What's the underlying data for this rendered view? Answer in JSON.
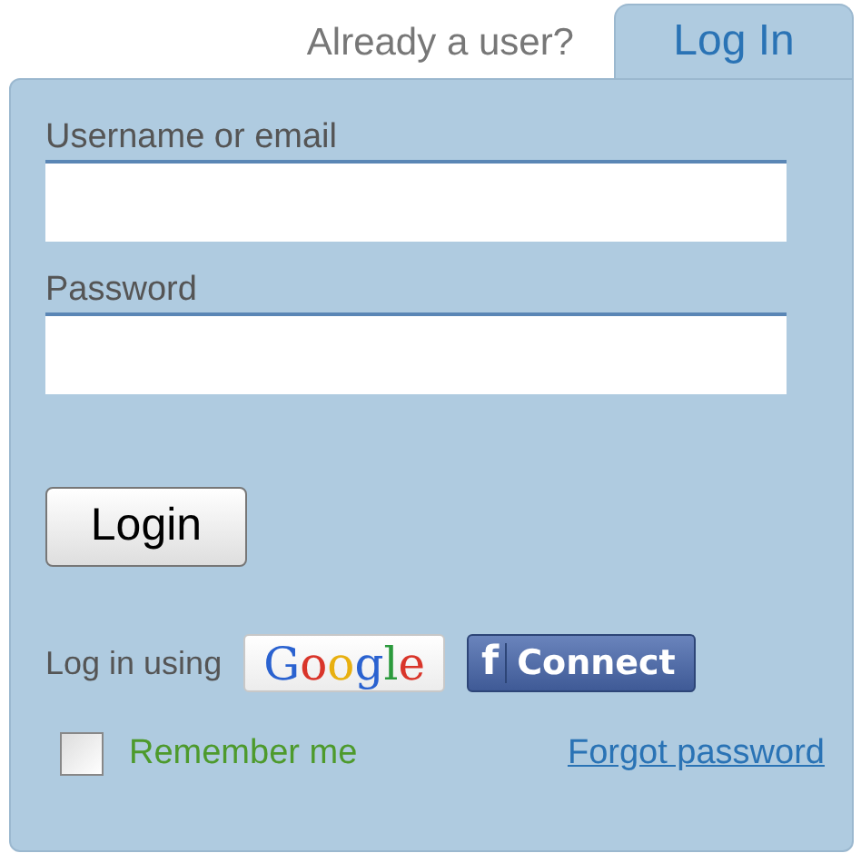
{
  "header": {
    "prompt": "Already a user?",
    "tab": {
      "label": "Log In",
      "selected": true
    }
  },
  "fields": [
    {
      "label": "Username or email"
    },
    {
      "label": "Password"
    }
  ],
  "submit": "Login",
  "social": {
    "label": "Log in using",
    "buttons": [
      {
        "kind": "google",
        "label": "Google"
      },
      {
        "kind": "facebook",
        "icon": "f",
        "label": "Connect"
      }
    ]
  },
  "remember": {
    "label": "Remember me",
    "checked": false
  },
  "forgot": "Forgot password"
}
